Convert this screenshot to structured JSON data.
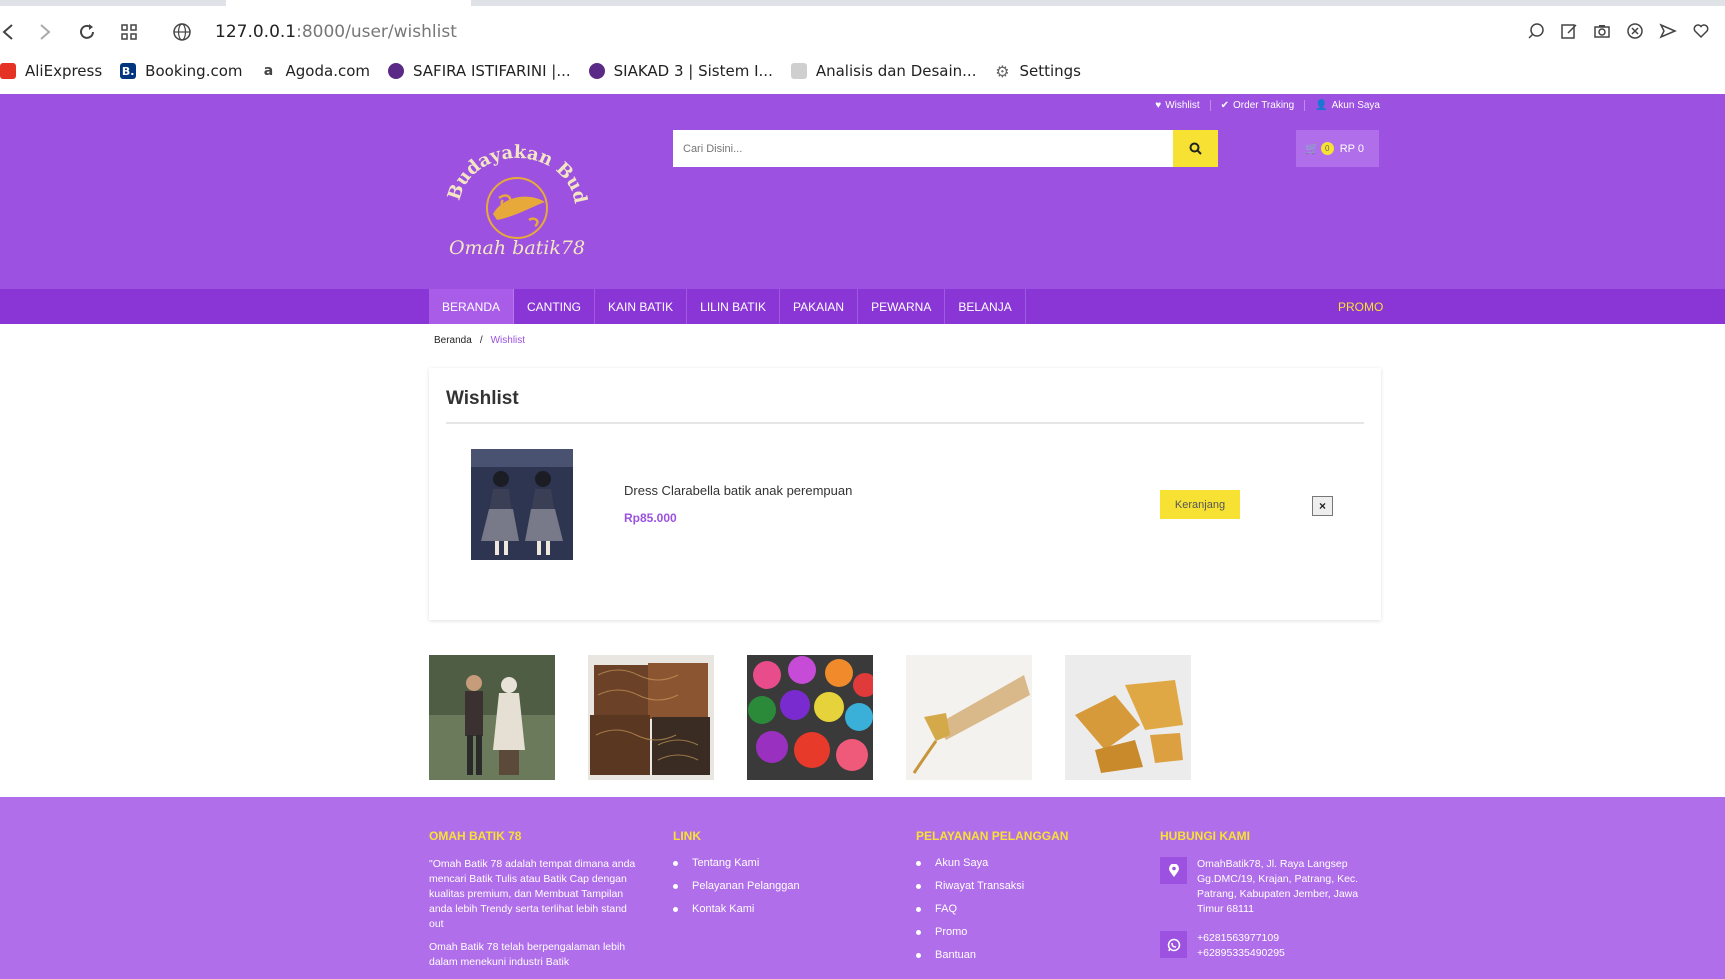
{
  "browser": {
    "url_host": "127.0.0.1",
    "url_path": ":8000/user/wishlist",
    "bookmarks": [
      {
        "label": "AliExpress",
        "icon": "aliexpress-icon",
        "color": "#e43225"
      },
      {
        "label": "Booking.com",
        "icon": "booking-icon",
        "color": "#003580"
      },
      {
        "label": "Agoda.com",
        "icon": "amazon-icon",
        "color": "#444444"
      },
      {
        "label": "SAFIRA ISTIFARINI |...",
        "icon": "university-seal-icon",
        "color": "#5b2a86"
      },
      {
        "label": "SIAKAD 3 | Sistem I...",
        "icon": "university-seal-icon",
        "color": "#5b2a86"
      },
      {
        "label": "Analisis dan Desain...",
        "icon": "document-icon",
        "color": "#777777"
      },
      {
        "label": "Settings",
        "icon": "gear-icon",
        "color": "#666666"
      }
    ]
  },
  "topbar": {
    "wishlist": "Wishlist",
    "order": "Order Traking",
    "account": "Akun Saya"
  },
  "search": {
    "placeholder": "Cari Disini..."
  },
  "cart": {
    "count": "0",
    "total": "RP 0"
  },
  "nav": {
    "items": [
      "BERANDA",
      "CANTING",
      "KAIN BATIK",
      "LILIN BATIK",
      "PAKAIAN",
      "PEWARNA",
      "BELANJA"
    ],
    "promo": "PROMO"
  },
  "breadcrumb": {
    "home": "Beranda",
    "sep": "/",
    "current": "Wishlist"
  },
  "wishlist": {
    "title": "Wishlist",
    "item": {
      "name": "Dress Clarabella batik anak perempuan",
      "price": "Rp85.000",
      "cart_label": "Keranjang",
      "remove_label": "×"
    }
  },
  "gallery": [
    "couple-batik-photo",
    "batik-fabric-photo",
    "dye-powder-photo",
    "canting-tool-photo",
    "wax-photo"
  ],
  "footer": {
    "about": {
      "title": "OMAH BATIK 78",
      "p1": "\"Omah Batik 78 adalah tempat dimana anda mencari Batik Tulis atau Batik Cap dengan kualitas premium, dan Membuat Tampilan anda lebih Trendy serta terlihat lebih stand out",
      "p2": "Omah Batik 78 telah berpengalaman lebih dalam menekuni industri Batik"
    },
    "link": {
      "title": "LINK",
      "items": [
        "Tentang Kami",
        "Pelayanan Pelanggan",
        "Kontak Kami"
      ]
    },
    "service": {
      "title": "PELAYANAN PELANGGAN",
      "items": [
        "Akun Saya",
        "Riwayat Transaksi",
        "FAQ",
        "Promo",
        "Bantuan"
      ]
    },
    "contact": {
      "title": "HUBUNGI KAMI",
      "address": "OmahBatik78, Jl. Raya Langsep Gg.DMC/19, Krajan, Patrang, Kec. Patrang, Kabupaten Jember, Jawa Timur 68111",
      "phone1": "+6281563977109",
      "phone2": "+62895335490295"
    }
  },
  "colors": {
    "header": "#9c51e0",
    "nav": "#8a36d6",
    "footer": "#b06eea",
    "accent": "#f7e234"
  }
}
